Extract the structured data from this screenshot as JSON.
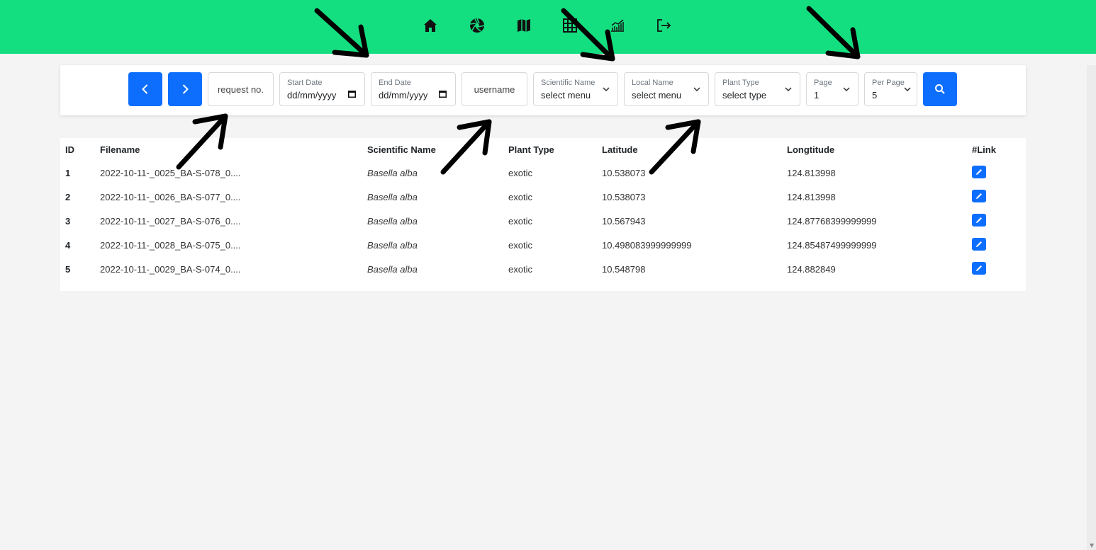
{
  "nav": {
    "icons": [
      "home-icon",
      "aperture-icon",
      "map-icon",
      "grid-icon",
      "chart-icon",
      "logout-icon"
    ]
  },
  "filters": {
    "prev_icon": "chevron-left-icon",
    "next_icon": "chevron-right-icon",
    "request_no_placeholder": "request no.",
    "start_date_label": "Start Date",
    "start_date_value": "dd/mm/yyyy",
    "end_date_label": "End Date",
    "end_date_value": "dd/mm/yyyy",
    "username_placeholder": "username",
    "scientific_name_label": "Scientific Name",
    "scientific_name_value": "select menu",
    "local_name_label": "Local Name",
    "local_name_value": "select menu",
    "plant_type_label": "Plant Type",
    "plant_type_value": "select type",
    "page_label": "Page",
    "page_value": "1",
    "per_page_label": "Per Page",
    "per_page_value": "5",
    "search_icon": "search-icon"
  },
  "table": {
    "headers": [
      "ID",
      "Filename",
      "Scientific Name",
      "Plant Type",
      "Latitude",
      "Longtitude",
      "#Link"
    ],
    "rows": [
      {
        "id": "1",
        "filename": "2022-10-11-_0025_BA-S-078_0....",
        "scientific_name": "Basella alba",
        "plant_type": "exotic",
        "latitude": "10.538073",
        "longitude": "124.813998"
      },
      {
        "id": "2",
        "filename": "2022-10-11-_0026_BA-S-077_0....",
        "scientific_name": "Basella alba",
        "plant_type": "exotic",
        "latitude": "10.538073",
        "longitude": "124.813998"
      },
      {
        "id": "3",
        "filename": "2022-10-11-_0027_BA-S-076_0....",
        "scientific_name": "Basella alba",
        "plant_type": "exotic",
        "latitude": "10.567943",
        "longitude": "124.87768399999999"
      },
      {
        "id": "4",
        "filename": "2022-10-11-_0028_BA-S-075_0....",
        "scientific_name": "Basella alba",
        "plant_type": "exotic",
        "latitude": "10.498083999999999",
        "longitude": "124.85487499999999"
      },
      {
        "id": "5",
        "filename": "2022-10-11-_0029_BA-S-074_0....",
        "scientific_name": "Basella alba",
        "plant_type": "exotic",
        "latitude": "10.548798",
        "longitude": "124.882849"
      }
    ],
    "edit_icon": "pencil-icon"
  },
  "colors": {
    "navbar": "#14df80",
    "primary": "#0d6efd",
    "background": "#f4f4f4"
  }
}
